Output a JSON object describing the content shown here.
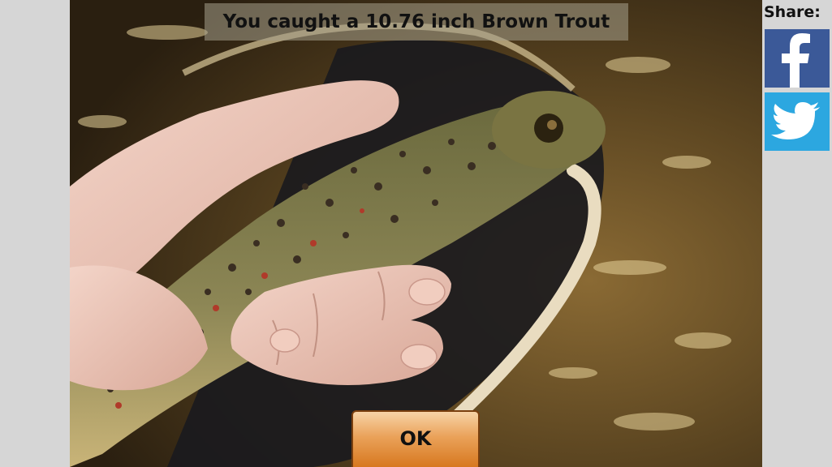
{
  "caption": {
    "text": "You caught a 10.76 inch Brown Trout"
  },
  "share": {
    "label": "Share:",
    "buttons": [
      {
        "icon": "facebook-icon",
        "color": "#3b5998"
      },
      {
        "icon": "twitter-icon",
        "color": "#2ca7e0"
      }
    ]
  },
  "ok_button": {
    "label": "OK"
  },
  "photo": {
    "subject": "brown-trout-in-hand-icon"
  },
  "colors": {
    "background": "#d6d6d6",
    "button_top": "#f7d3a6",
    "button_bottom": "#d7781f"
  }
}
